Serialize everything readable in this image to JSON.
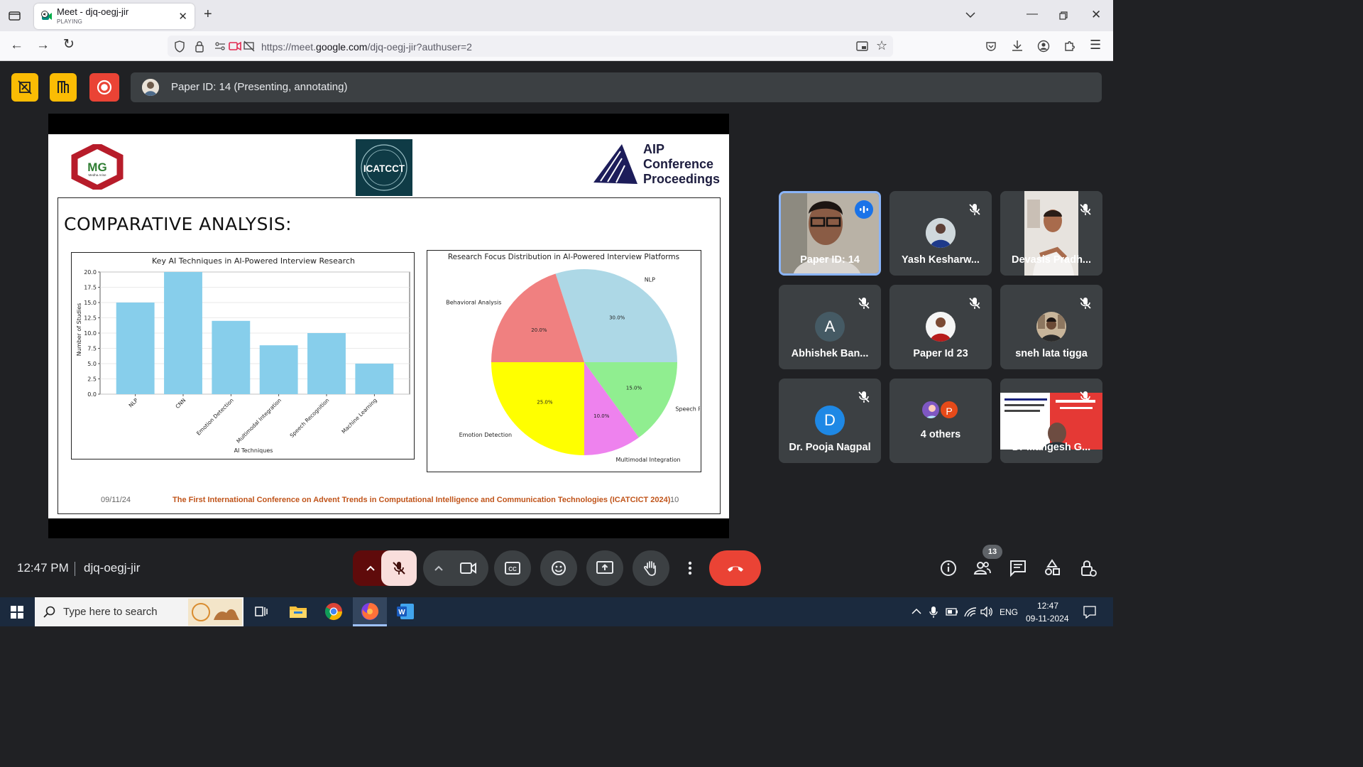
{
  "browser": {
    "tab_title": "Meet - djq-oegj-jir",
    "tab_status": "PLAYING",
    "url_prefix": "https://meet.",
    "url_domain": "google.com",
    "url_path": "/djq-oegj-jir?authuser=2"
  },
  "meet": {
    "presenting_label": "Paper ID: 14 (Presenting, annotating)",
    "clock": "12:47 PM",
    "meeting_code": "djq-oegj-jir",
    "participants_count": "13"
  },
  "slide": {
    "logo_mg": "MG",
    "logo_mg_sub": "Medha Arise",
    "logo_icat": "ICATCCT",
    "aip_line1": "AIP",
    "aip_line2": "Conference",
    "aip_line3": "Proceedings",
    "title": "COMPARATIVE ANALYSIS:",
    "footer_date": "09/11/24",
    "footer_conference": "The First International Conference on Advent Trends in Computational Intelligence and Communication Technologies (ICATCICT 2024)",
    "footer_page": "10"
  },
  "chart_data": [
    {
      "type": "bar",
      "title": "Key AI Techniques in AI-Powered Interview Research",
      "xlabel": "AI Techniques",
      "ylabel": "Number of Studies",
      "categories": [
        "NLP",
        "CNN",
        "Emotion Detection",
        "Multimodal Integration",
        "Speech Recognition",
        "Machine Learning"
      ],
      "values": [
        15,
        20,
        12,
        8,
        10,
        5
      ],
      "yticks": [
        "0.0",
        "2.5",
        "5.0",
        "7.5",
        "10.0",
        "12.5",
        "15.0",
        "17.5",
        "20.0"
      ],
      "ylim": [
        0,
        20
      ],
      "color": "#87ceeb",
      "grid": true
    },
    {
      "type": "pie",
      "title": "Research Focus Distribution in AI-Powered Interview Platforms",
      "slices": [
        {
          "label": "NLP",
          "value": 30,
          "pct": "30.0%",
          "color": "#add8e6"
        },
        {
          "label": "Behavioral Analysis",
          "value": 20,
          "pct": "20.0%",
          "color": "#f08080"
        },
        {
          "label": "Emotion Detection",
          "value": 25,
          "pct": "25.0%",
          "color": "#ffff00"
        },
        {
          "label": "Multimodal Integration",
          "value": 10,
          "pct": "10.0%",
          "color": "#ee82ee"
        },
        {
          "label": "Speech Recognition",
          "value": 15,
          "pct": "15.0%",
          "color": "#90ee90"
        }
      ]
    }
  ],
  "participants": [
    {
      "name": "Paper ID: 14",
      "kind": "video",
      "speaking": true
    },
    {
      "name": "Yash Kesharw...",
      "kind": "photo",
      "muted": true
    },
    {
      "name": "Devasis Pradh...",
      "kind": "video",
      "muted": true
    },
    {
      "name": "Abhishek Ban...",
      "kind": "letter",
      "letter": "A",
      "color": "#455a64",
      "muted": true
    },
    {
      "name": "Paper Id 23",
      "kind": "photo",
      "muted": true
    },
    {
      "name": "sneh lata tigga",
      "kind": "photo",
      "muted": true
    },
    {
      "name": "Dr. Pooja Nagpal",
      "kind": "letter",
      "letter": "D",
      "color": "#1e88e5",
      "muted": true
    },
    {
      "name": "4 others",
      "kind": "group",
      "letter": "P"
    },
    {
      "name": "Dr Mangesh G...",
      "kind": "video",
      "muted": true
    }
  ],
  "taskbar": {
    "search_placeholder": "Type here to search",
    "language": "ENG",
    "time": "12:47",
    "date": "09-11-2024"
  },
  "icons": [
    "tab-list-icon",
    "speaker-icon",
    "new-tab-icon",
    "back-icon",
    "forward-icon",
    "reload-icon",
    "shield-icon",
    "lock-icon",
    "camera-off-icon",
    "star-icon",
    "download-icon",
    "account-icon",
    "extensions-icon",
    "menu-icon",
    "mic-off-icon",
    "video-icon",
    "captions-icon",
    "emoji-icon",
    "present-icon",
    "raise-hand-icon",
    "more-icon",
    "end-call-icon",
    "info-icon",
    "people-icon",
    "chat-icon",
    "activities-icon",
    "host-controls-icon"
  ]
}
